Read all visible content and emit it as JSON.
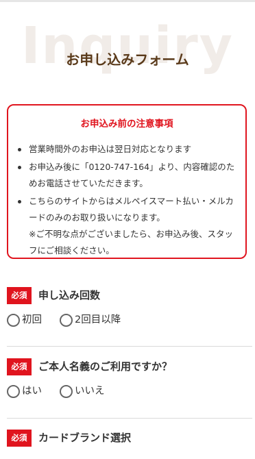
{
  "hero": {
    "background_word": "Inquiry",
    "title": "お申し込みフォーム"
  },
  "notice": {
    "title": "お申込み前の注意事項",
    "items": [
      {
        "text": "営業時間外のお申込は翌日対応となります"
      },
      {
        "text": "お申込み後に「0120-747-164」より、内容確認のためお電話させていただきます。"
      },
      {
        "text": "こちらのサイトからはメルペイスマート払い・メルカードのみのお取り扱いになります。",
        "extra": "※ご不明な点がございましたら、お申込み後、スタッフにご相談ください。"
      }
    ]
  },
  "form": {
    "required_label": "必須",
    "questions": [
      {
        "label": "申し込み回数",
        "options": [
          "初回",
          "2回目以降"
        ]
      },
      {
        "label": "ご本人名義のご利用ですか？",
        "options": [
          "はい",
          "いいえ"
        ]
      },
      {
        "label": "カードブランド選択",
        "options": []
      }
    ]
  },
  "colors": {
    "accent_red": "#e0141e",
    "title_brown": "#5a3a1a",
    "background_word": "#f1ece8"
  }
}
